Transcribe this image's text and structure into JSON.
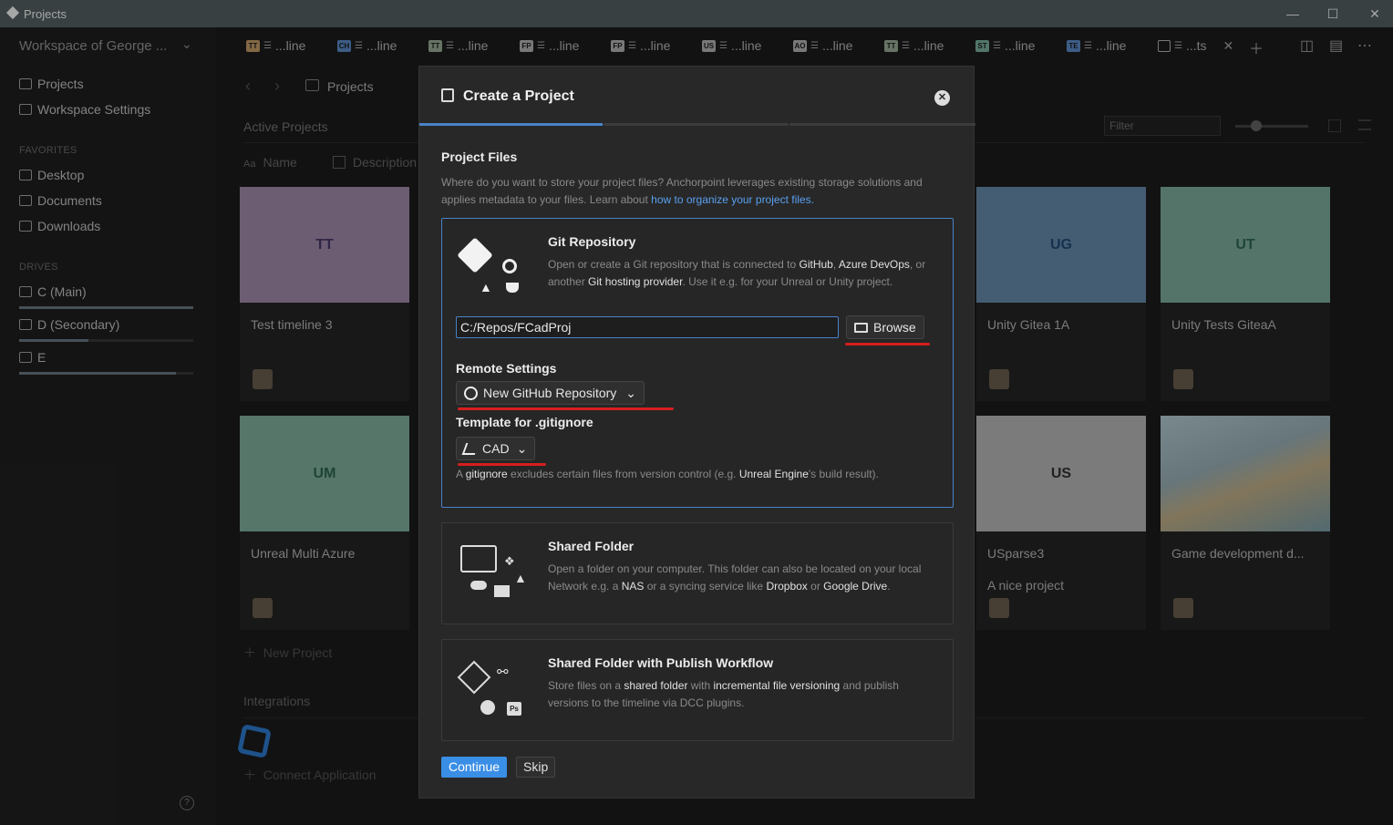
{
  "window": {
    "title": "Projects"
  },
  "sidebar": {
    "workspace": "Workspace of George ...",
    "nav": [
      "Projects",
      "Workspace Settings"
    ],
    "favorites_label": "FAVORITES",
    "favorites": [
      "Desktop",
      "Documents",
      "Downloads"
    ],
    "drives_label": "DRIVES",
    "drives": [
      {
        "label": "C (Main)",
        "used": 1.0
      },
      {
        "label": "D (Secondary)",
        "used": 0.4
      },
      {
        "label": "E",
        "used": 0.9
      }
    ]
  },
  "tabs": [
    {
      "badge": "TT",
      "label": "...line",
      "color": "#c9a06b"
    },
    {
      "badge": "CH",
      "label": "...line",
      "color": "#5e8fd0"
    },
    {
      "badge": "TT",
      "label": "...line",
      "color": "#9fb39c"
    },
    {
      "badge": "FP",
      "label": "...line",
      "color": "#b8b8b8"
    },
    {
      "badge": "FP",
      "label": "...line",
      "color": "#b8b8b8"
    },
    {
      "badge": "US",
      "label": "...line",
      "color": "#b8b8b8"
    },
    {
      "badge": "AO",
      "label": "...line",
      "color": "#b8b8b8"
    },
    {
      "badge": "TT",
      "label": "...line",
      "color": "#9fb39c"
    },
    {
      "badge": "ST",
      "label": "...line",
      "color": "#7fb5a4"
    },
    {
      "badge": "TE",
      "label": "...line",
      "color": "#5e8fd0"
    },
    {
      "badge": "",
      "label": "...ts",
      "color": "#bbbbbb"
    }
  ],
  "main": {
    "breadcrumb": "Projects",
    "active_projects": "Active Projects",
    "col_name": "Name",
    "col_description": "Description",
    "filter_placeholder": "Filter",
    "new_project": "New Project",
    "integrations": "Integrations",
    "connect_application": "Connect Application",
    "cards": [
      {
        "initials": "TT",
        "name": "Test timeline 3",
        "color": "#a68fb1",
        "text": "#4b3a6e",
        "desc": ""
      },
      {
        "initials": "UG",
        "name": "Unity Gitea 1A",
        "color": "#6a8fb0",
        "text": "#234b7a",
        "desc": ""
      },
      {
        "initials": "UT",
        "name": "Unity Tests GiteaA",
        "color": "#82b3a3",
        "text": "#2e6b58",
        "desc": ""
      },
      {
        "initials": "UM",
        "name": "Unreal Multi Azure",
        "color": "#84b5a3",
        "text": "#2e6b55",
        "desc": ""
      },
      {
        "initials": "US",
        "name": "USparse3",
        "color": "#bdbdbd",
        "text": "#333333",
        "desc": "A nice project"
      },
      {
        "initials": "",
        "name": "Game development d...",
        "color": "#9cb3b8",
        "text": "#333333",
        "desc": ""
      }
    ]
  },
  "dialog": {
    "title": "Create a Project",
    "section": "Project Files",
    "intro": "Where do you want to store your project files? Anchorpoint leverages existing storage solutions and applies metadata to your files. Learn about ",
    "intro_link": "how to organize your project files.",
    "git": {
      "title": "Git Repository",
      "desc1": "Open or create a Git repository that is connected to ",
      "b1": "GitHub",
      "sep": ", ",
      "b2": "Azure DevOps",
      "desc2": ", or another ",
      "b3": "Git hosting provider",
      "desc3": ". Use it e.g. for your Unreal or Unity project.",
      "path": "C:/Repos/FCadProj",
      "browse": "Browse",
      "remote_label": "Remote Settings",
      "remote_value": "New GitHub Repository",
      "template_label": "Template for .gitignore",
      "template_value": "CAD",
      "note1": "A ",
      "note_b1": "gitignore",
      "note2": " excludes certain files from version control (e.g. ",
      "note_b2": "Unreal Engine",
      "note3": "'s build result)."
    },
    "shared": {
      "title": "Shared Folder",
      "desc1": "Open a folder on your computer. This folder can also be located on your local Network e.g. a ",
      "b1": "NAS",
      "desc2": " or a syncing service like ",
      "b2": "Dropbox",
      "desc3": " or ",
      "b3": "Google Drive",
      "desc4": "."
    },
    "publish": {
      "title": "Shared Folder with Publish Workflow",
      "desc1": "Store files on a ",
      "b1": "shared folder",
      "desc2": " with ",
      "b2": "incremental file versioning",
      "desc3": " and publish versions to the timeline via DCC plugins."
    },
    "continue": "Continue",
    "skip": "Skip"
  }
}
